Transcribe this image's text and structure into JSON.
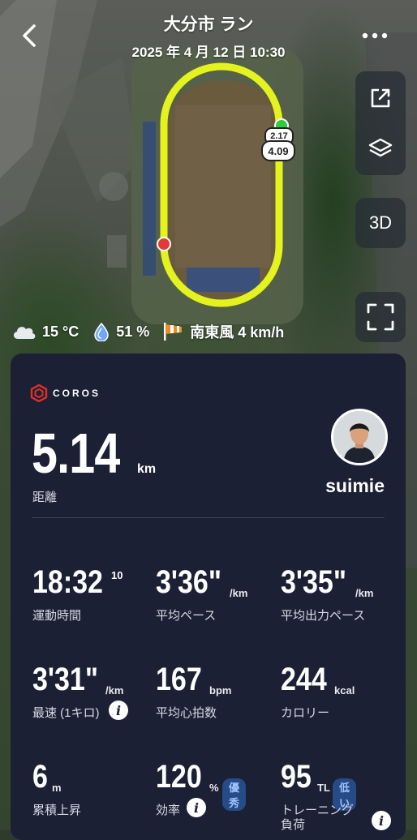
{
  "header": {
    "title": "大分市 ラン",
    "datetime": "2025 年 4 月 12 日  10:30"
  },
  "map": {
    "lap_marker": "2.17",
    "distance_marker": "4.09",
    "controls": {
      "d3_label": "3D"
    }
  },
  "weather": {
    "temperature": "15 °C",
    "humidity": "51 %",
    "wind": "南東風 4 km/h"
  },
  "summary": {
    "brand": "COROS",
    "distance_value": "5.14",
    "distance_unit": "km",
    "distance_label": "距離",
    "username": "suimie"
  },
  "stats": {
    "moving_time": {
      "value": "18:32",
      "sub": "10",
      "label": "運動時間"
    },
    "avg_pace": {
      "value": "3'36\"",
      "unit": "/km",
      "label": "平均ペース"
    },
    "avg_power_pace": {
      "value": "3'35\"",
      "unit": "/km",
      "label": "平均出力ペース"
    },
    "fastest_km": {
      "value": "3'31\"",
      "unit": "/km",
      "label": "最速 (1キロ)"
    },
    "avg_hr": {
      "value": "167",
      "unit": "bpm",
      "label": "平均心拍数"
    },
    "calories": {
      "value": "244",
      "unit": "kcal",
      "label": "カロリー"
    },
    "elevation_gain": {
      "value": "6",
      "unit": "m",
      "label": "累積上昇"
    },
    "efficiency": {
      "value": "120",
      "unit": "%",
      "badge": "優秀",
      "label": "効率"
    },
    "training_load": {
      "value": "95",
      "unit": "TL",
      "badge": "低い",
      "label_line1": "トレーニング",
      "label_line2": "負荷"
    }
  },
  "colors": {
    "route": "#e4f21e",
    "card_bg": "#1b2035",
    "start_marker": "#2ecc40",
    "end_marker": "#e53935",
    "badge_bg": "#264b86",
    "brand_red": "#e0302a"
  }
}
